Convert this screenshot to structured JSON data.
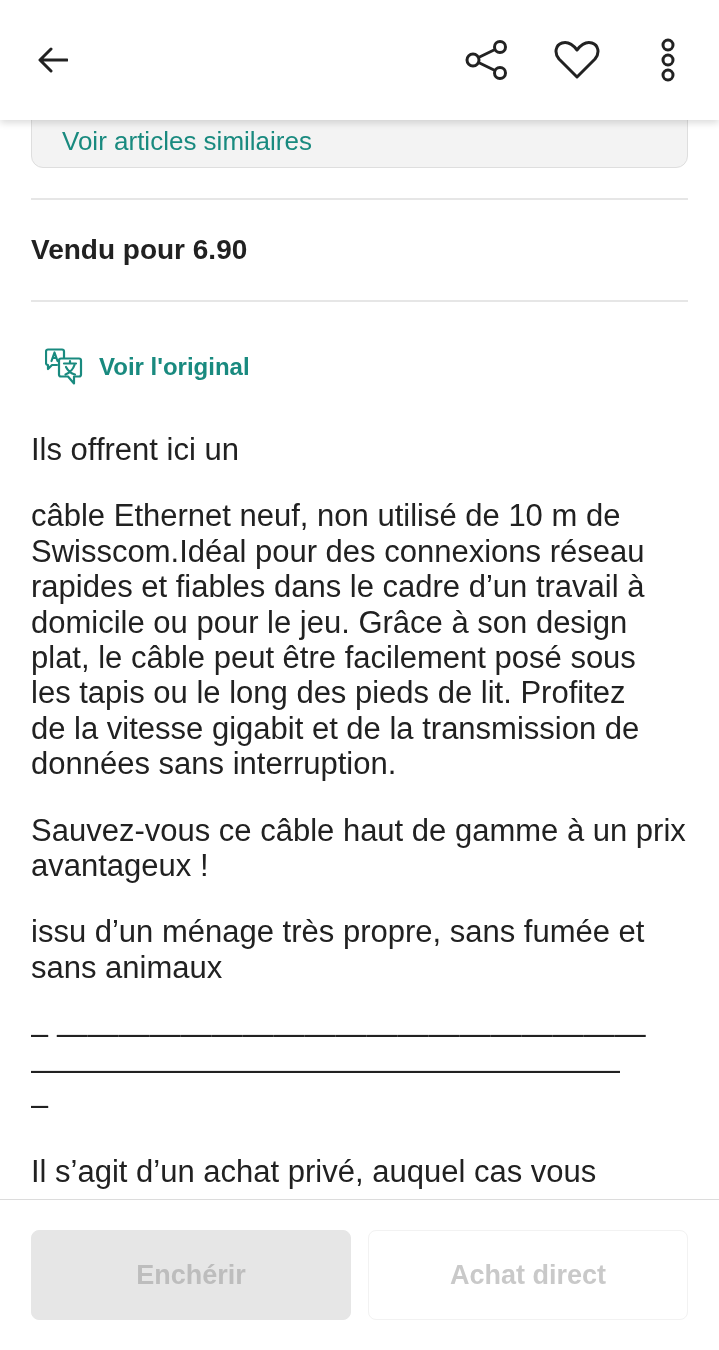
{
  "similar_card": {
    "link": "Voir articles similaires"
  },
  "sale": {
    "text": "Vendu pour 6.90"
  },
  "translation": {
    "link": "Voir l'original"
  },
  "description": {
    "paragraphs": [
      "Ils offrent ici un",
      "câble Ethernet neuf, non utilisé de 10 m de\nSwisscom.Idéal pour des connexions réseau\nrapides et fiables dans le cadre d’un travail à\ndomicile ou pour le jeu. Grâce à son design\nplat, le câble peut être facilement posé sous\nles tapis ou le long des pieds de lit. Profitez\nde la vitesse gigabit et de la transmission de\ndonnées sans interruption.",
      "Sauvez-vous ce câble haut de gamme à un prix\navantageux !",
      "issu d’un ménage très propre, sans fumée et\nsans animaux",
      "– ———————————————————\n———————————————————\n–",
      "Il s’agit d’un achat privé, auquel cas vous"
    ]
  },
  "actions": [
    {
      "label": "Enchérir",
      "kind": "filled",
      "disabled": true
    },
    {
      "label": "Achat direct",
      "kind": "outlined",
      "disabled": true
    }
  ]
}
